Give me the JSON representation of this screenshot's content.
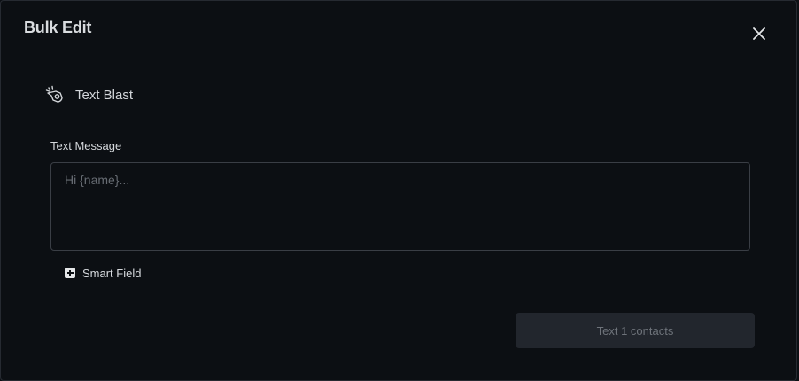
{
  "modal": {
    "title": "Bulk Edit",
    "close_icon": "close-icon"
  },
  "blast": {
    "icon": "megaphone-icon",
    "label": "Text Blast"
  },
  "message": {
    "label": "Text Message",
    "value": "",
    "placeholder": "Hi {name}..."
  },
  "smart_field": {
    "icon": "plus-square-icon",
    "label": "Smart Field"
  },
  "submit": {
    "label": "Text 1 contacts",
    "disabled": true
  },
  "colors": {
    "background": "#0c0f13",
    "border": "#3a3e45",
    "text": "#d6d9dd",
    "placeholder": "#676c73",
    "button_bg": "#22262d",
    "button_text": "#6e737a"
  }
}
